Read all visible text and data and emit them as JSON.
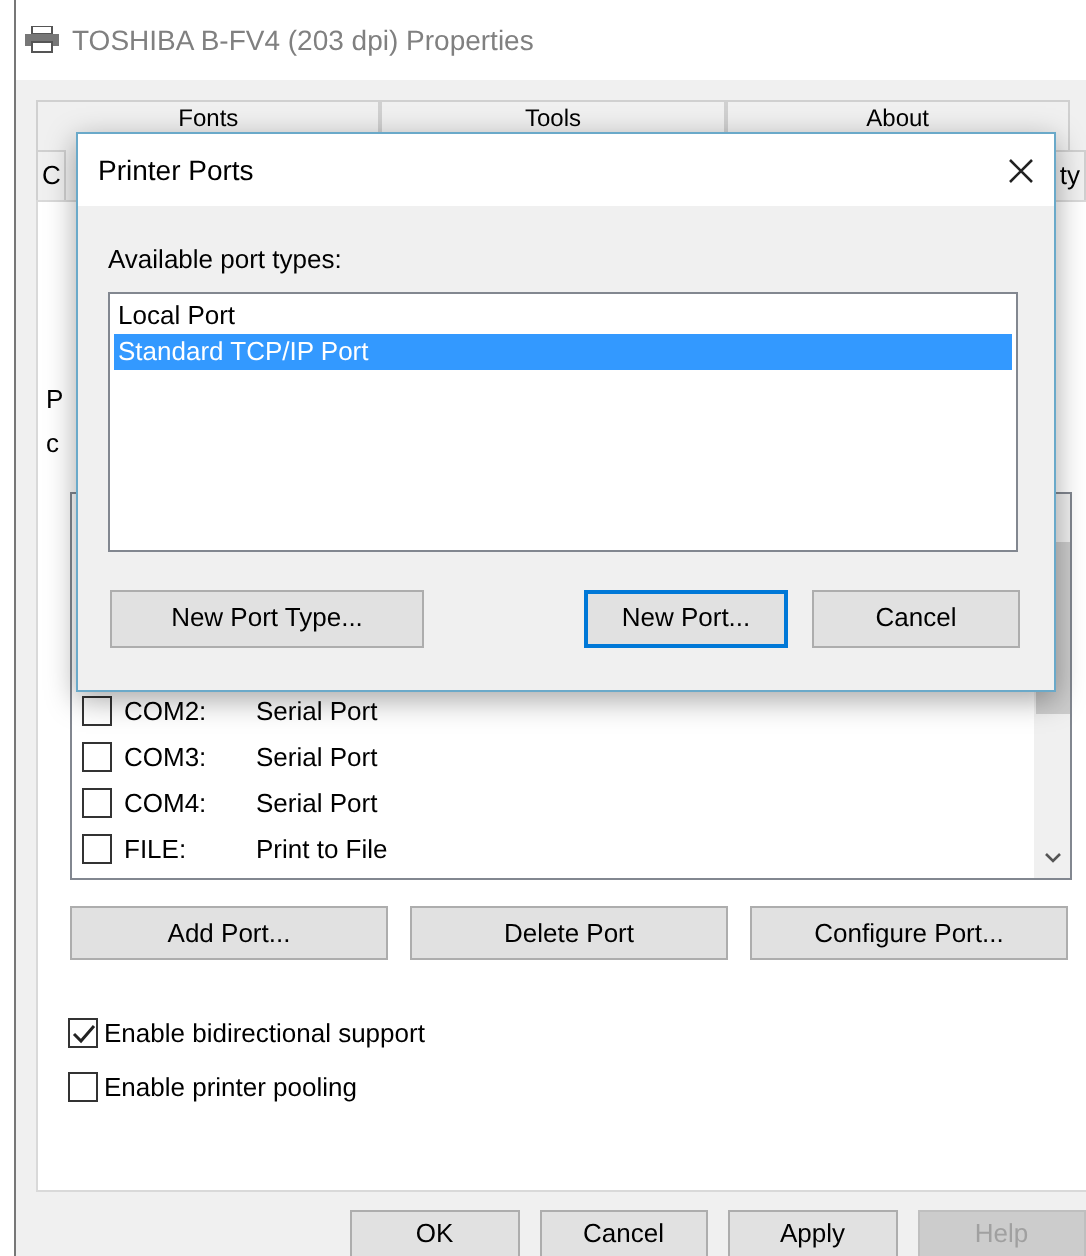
{
  "window": {
    "title": "TOSHIBA B-FV4 (203 dpi) Properties"
  },
  "tabs_row_1": [
    {
      "label": "Fonts",
      "selected": false
    },
    {
      "label": "Tools",
      "selected": false
    },
    {
      "label": "About",
      "selected": false
    }
  ],
  "tabs_row_2": [
    {
      "label": "C",
      "selected": false
    },
    {
      "label": "ty",
      "selected": false
    }
  ],
  "panel_fragments": [
    "P",
    "c"
  ],
  "ports": [
    {
      "port": "COM2:",
      "description": "Serial Port",
      "checked": false
    },
    {
      "port": "COM3:",
      "description": "Serial Port",
      "checked": false
    },
    {
      "port": "COM4:",
      "description": "Serial Port",
      "checked": false
    },
    {
      "port": "FILE:",
      "description": "Print to File",
      "checked": false
    }
  ],
  "port_buttons": [
    "Add Port...",
    "Delete Port",
    "Configure Port..."
  ],
  "options": [
    {
      "label": "Enable bidirectional support",
      "checked": true
    },
    {
      "label": "Enable printer pooling",
      "checked": false
    }
  ],
  "footer_buttons": [
    {
      "label": "OK",
      "disabled": false
    },
    {
      "label": "Cancel",
      "disabled": false
    },
    {
      "label": "Apply",
      "disabled": false
    },
    {
      "label": "Help",
      "disabled": true
    }
  ],
  "dialog": {
    "title": "Printer Ports",
    "prompt": "Available port types:",
    "port_types": [
      {
        "label": "Local Port",
        "selected": false
      },
      {
        "label": "Standard TCP/IP Port",
        "selected": true
      }
    ],
    "buttons": [
      {
        "label": "New Port Type...",
        "default": false
      },
      {
        "label": "New Port...",
        "default": true
      },
      {
        "label": "Cancel",
        "default": false
      }
    ]
  }
}
